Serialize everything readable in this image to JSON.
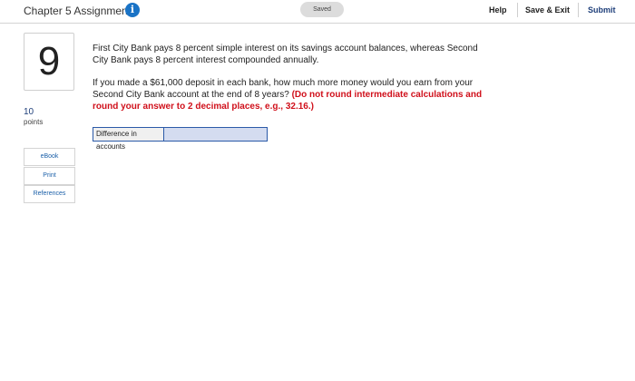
{
  "header": {
    "title": "Chapter 5 Assignment",
    "info_glyph": "i",
    "saved_label": "Saved",
    "help_label": "Help",
    "save_exit_label": "Save & Exit",
    "submit_label": "Submit"
  },
  "question": {
    "number": "9",
    "points_value": "10",
    "points_label": "points",
    "paragraph_1": "First City Bank pays 8 percent simple interest on its savings account balances, whereas Second City Bank pays 8 percent interest compounded annually.",
    "paragraph_2": "If you made a $61,000 deposit in each bank, how much more money would you earn from your Second City Bank account at the end of 8 years?",
    "instruction": "(Do not round intermediate calculations and round your answer to 2 decimal places, e.g., 32.16.)"
  },
  "answer": {
    "label": "Difference in accounts",
    "value": "",
    "placeholder": ""
  },
  "sidebar": {
    "ebook_label": "eBook",
    "print_label": "Print",
    "references_label": "References"
  },
  "colors": {
    "accent_blue": "#1a73c6",
    "instruction_red": "#d0101b",
    "input_fill": "#d4dcf0",
    "input_border": "#2b5aa8"
  },
  "icons": {
    "info": "info-icon"
  }
}
